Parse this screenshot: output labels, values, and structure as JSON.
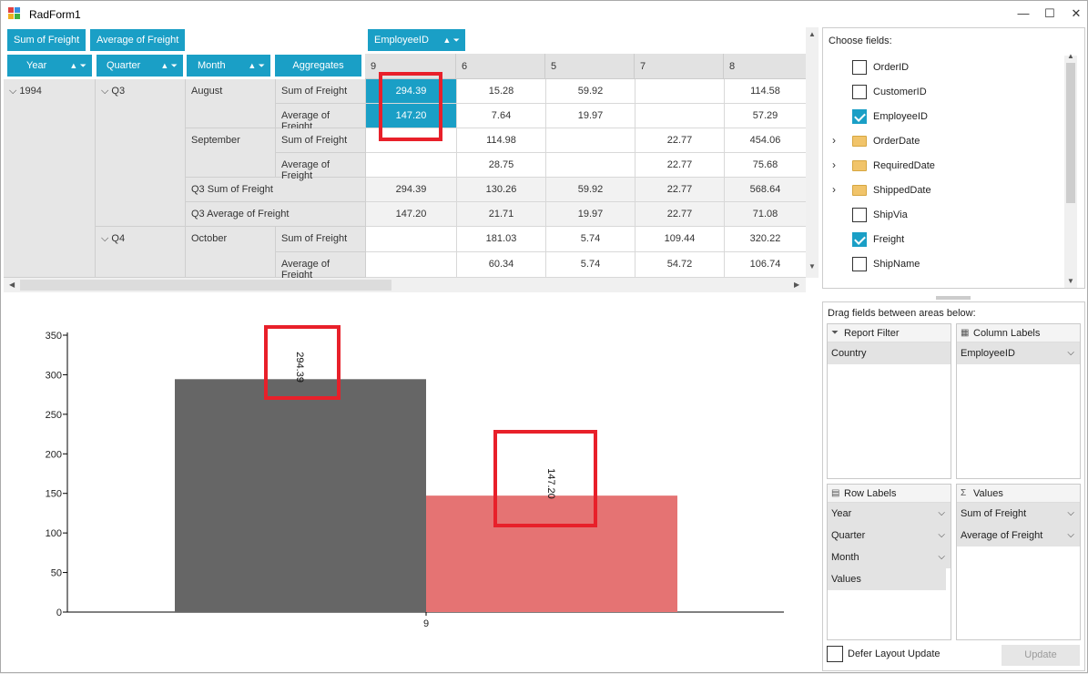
{
  "window": {
    "title": "RadForm1",
    "minimize": "—",
    "maximize": "☐",
    "close": "✕"
  },
  "pivot": {
    "data_chips": [
      "Sum of Freight",
      "Average of Freight"
    ],
    "column_chip": "EmployeeID",
    "row_chips": [
      "Year",
      "Quarter",
      "Month"
    ],
    "aggregates_chip": "Aggregates",
    "column_headers": [
      "9",
      "6",
      "5",
      "7",
      "8"
    ],
    "year": "1994",
    "q3": "Q3",
    "q4": "Q4",
    "august": "August",
    "september": "September",
    "october": "October",
    "sum_label": "Sum of Freight",
    "avg_label": "Average of Freight",
    "q3_sum_label": "Q3 Sum of Freight",
    "q3_avg_label": "Q3 Average of Freight",
    "rows": [
      [
        "294.39",
        "15.28",
        "59.92",
        "",
        "114.58"
      ],
      [
        "147.20",
        "7.64",
        "19.97",
        "",
        "57.29"
      ],
      [
        "",
        "114.98",
        "",
        "22.77",
        "454.06"
      ],
      [
        "",
        "28.75",
        "",
        "22.77",
        "75.68"
      ],
      [
        "294.39",
        "130.26",
        "59.92",
        "22.77",
        "568.64"
      ],
      [
        "147.20",
        "21.71",
        "19.97",
        "22.77",
        "71.08"
      ],
      [
        "",
        "181.03",
        "5.74",
        "109.44",
        "320.22"
      ],
      [
        "",
        "60.34",
        "5.74",
        "54.72",
        "106.74"
      ]
    ]
  },
  "chart_data": {
    "type": "bar",
    "categories": [
      "9"
    ],
    "series": [
      {
        "values": [
          294.39
        ],
        "color": "#666666"
      },
      {
        "values": [
          147.2
        ],
        "color": "#e57373"
      }
    ],
    "data_labels": [
      "294.39",
      "147.20"
    ],
    "yticks": [
      "0",
      "50",
      "100",
      "150",
      "200",
      "250",
      "300",
      "350"
    ],
    "ylim": [
      0,
      350
    ],
    "grid": false
  },
  "field_list": {
    "label": "Choose fields:",
    "items": [
      {
        "name": "OrderID",
        "kind": "checkbox",
        "checked": false
      },
      {
        "name": "CustomerID",
        "kind": "checkbox",
        "checked": false
      },
      {
        "name": "EmployeeID",
        "kind": "checkbox",
        "checked": true
      },
      {
        "name": "OrderDate",
        "kind": "folder"
      },
      {
        "name": "RequiredDate",
        "kind": "folder"
      },
      {
        "name": "ShippedDate",
        "kind": "folder"
      },
      {
        "name": "ShipVia",
        "kind": "checkbox",
        "checked": false
      },
      {
        "name": "Freight",
        "kind": "checkbox",
        "checked": true
      },
      {
        "name": "ShipName",
        "kind": "checkbox",
        "checked": false
      }
    ]
  },
  "areas": {
    "label": "Drag fields between areas below:",
    "report_filter": {
      "title": "Report Filter",
      "items": [
        "Country"
      ]
    },
    "column_labels": {
      "title": "Column Labels",
      "items": [
        "EmployeeID"
      ]
    },
    "row_labels": {
      "title": "Row Labels",
      "items": [
        "Year",
        "Quarter",
        "Month",
        "Values"
      ]
    },
    "values": {
      "title": "Values",
      "items": [
        "Sum of Freight",
        "Average of Freight"
      ]
    },
    "defer_label": "Defer Layout Update",
    "update_label": "Update"
  },
  "colors": {
    "accent": "#1a9fc6",
    "highlight": "#e8202a",
    "bar1": "#666666",
    "bar2": "#e57373"
  }
}
